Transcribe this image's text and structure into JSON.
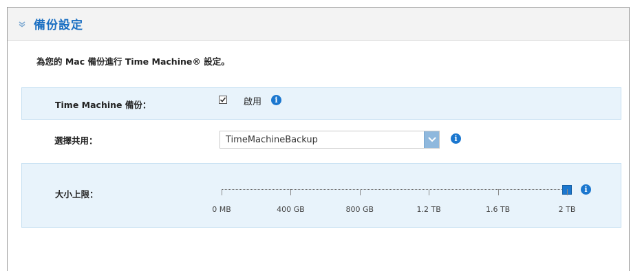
{
  "header": {
    "title": "備份設定",
    "chevron_icon": "chevron-down-icon"
  },
  "description": "為您的 Mac 備份進行 Time Machine® 設定。",
  "time_machine": {
    "label": "Time Machine 備份：",
    "checkbox_checked": true,
    "checkbox_label": "啟用"
  },
  "share": {
    "label": "選擇共用：",
    "selected_value": "TimeMachineBackup"
  },
  "size_limit": {
    "label": "大小上限：",
    "ticks": [
      "0 MB",
      "400 GB",
      "800 GB",
      "1.2 TB",
      "1.6 TB",
      "2 TB"
    ],
    "value_fraction": 1.0
  },
  "colors": {
    "accent": "#1b77cf",
    "title": "#1a6fc2",
    "shaded_row": "#e8f3fb"
  }
}
